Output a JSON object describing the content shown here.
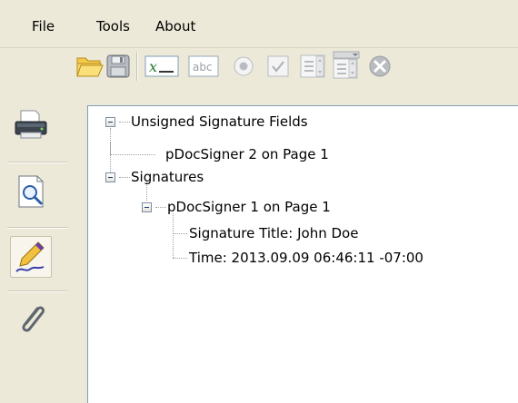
{
  "menu": {
    "file": "File",
    "tools": "Tools",
    "about": "About"
  },
  "toolbar": {
    "buttons": [
      {
        "name": "open-folder-icon"
      },
      {
        "name": "save-disk-icon"
      },
      {
        "name": "formula-field-icon"
      },
      {
        "name": "text-field-icon",
        "label": "abc"
      },
      {
        "name": "radio-button-icon"
      },
      {
        "name": "checkbox-icon"
      },
      {
        "name": "list-box-icon"
      },
      {
        "name": "combo-box-icon"
      },
      {
        "name": "delete-icon"
      }
    ],
    "formula_glyph": "x"
  },
  "sidebar": {
    "items": [
      {
        "name": "printer-icon"
      },
      {
        "name": "print-preview-icon"
      },
      {
        "name": "signature-pen-icon",
        "active": true
      },
      {
        "name": "attachment-paperclip-icon"
      }
    ]
  },
  "tree": {
    "unsigned_fields": {
      "label": "Unsigned Signature Fields",
      "children": [
        {
          "label": "pDocSigner 2 on Page 1"
        }
      ]
    },
    "signatures": {
      "label": "Signatures",
      "children": [
        {
          "label": "pDocSigner 1 on Page 1",
          "details": [
            {
              "label": "Signature Title: John Doe"
            },
            {
              "label": "Time: 2013.09.09 06:46:11 -07:00"
            }
          ]
        }
      ]
    }
  },
  "colors": {
    "background": "#ece9d8",
    "tree_background": "#ffffff",
    "tree_border": "#7f9db9"
  }
}
